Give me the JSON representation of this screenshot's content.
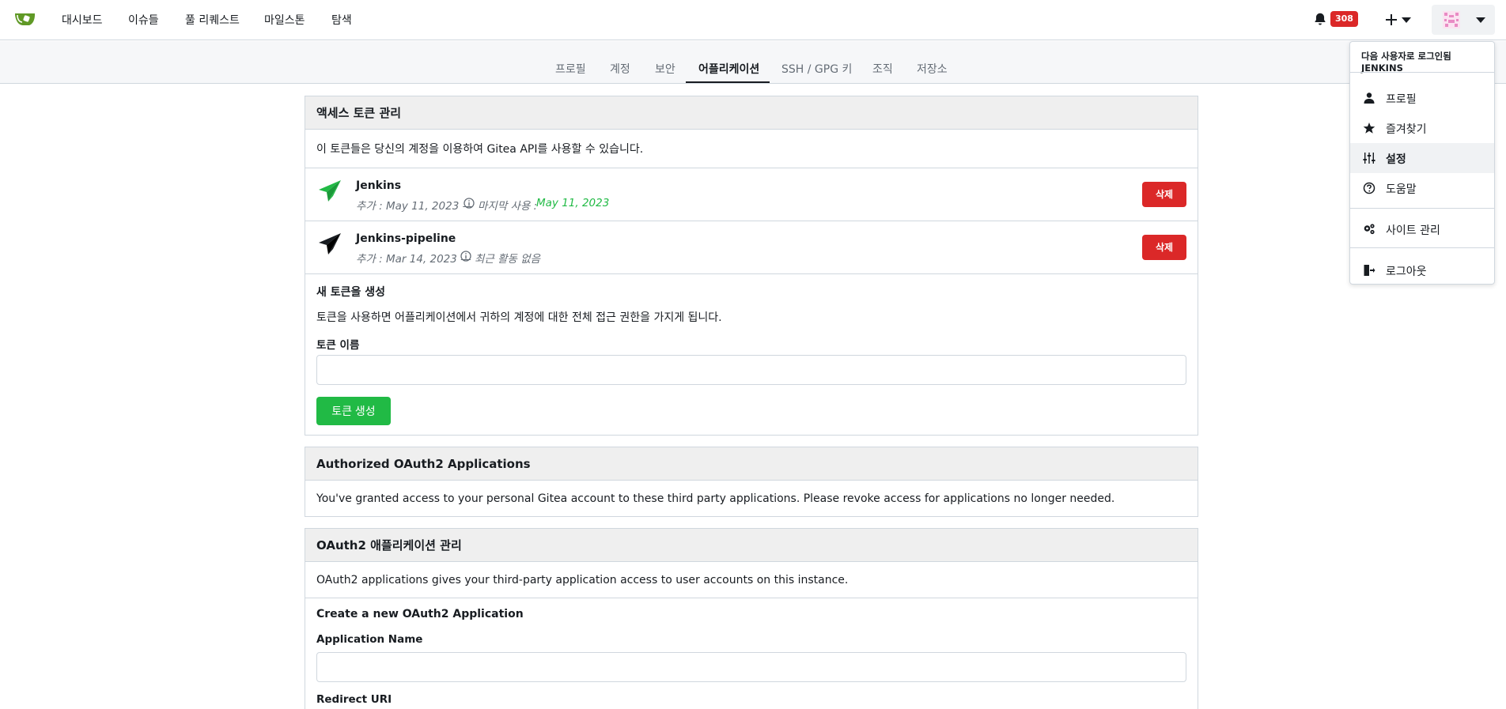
{
  "nav": {
    "items": [
      "대시보드",
      "이슈들",
      "풀 리퀘스트",
      "마일스톤",
      "탐색"
    ],
    "notification_count": "308"
  },
  "tabs": {
    "items": [
      "프로필",
      "계정",
      "보안",
      "어플리케이션",
      "SSH / GPG 키",
      "조직",
      "저장소"
    ],
    "active": "어플리케이션"
  },
  "tokens": {
    "title": "액세스 토큰 관리",
    "description": "이 토큰들은 당신의 계정을 이용하여 Gitea API를 사용할 수 있습니다.",
    "list": [
      {
        "name": "Jenkins",
        "added_label": "추가 : May 11, 2023 —",
        "usage_label": "마지막 사용 :",
        "usage_value": "May 11, 2023",
        "delete_label": "삭제",
        "icon_color": "#21ba45"
      },
      {
        "name": "Jenkins-pipeline",
        "added_label": "추가 : Mar 14, 2023 —",
        "usage_label": "최근 활동 없음",
        "usage_value": "",
        "delete_label": "삭제",
        "icon_color": "#181c21"
      }
    ],
    "new_title": "새 토큰을 생성",
    "new_desc": "토큰을 사용하면 어플리케이션에서 귀하의 계정에 대한 전체 접근 권한을 가지게 됩니다.",
    "name_label": "토큰 이름",
    "name_value": "",
    "generate_label": "토큰 생성"
  },
  "authorized": {
    "title": "Authorized OAuth2 Applications",
    "description": "You've granted access to your personal Gitea account to these third party applications. Please revoke access for applications no longer needed."
  },
  "oauth": {
    "title": "OAuth2 애플리케이션 관리",
    "description": "OAuth2 applications gives your third-party application access to user accounts on this instance.",
    "create_title": "Create a new OAuth2 Application",
    "app_name_label": "Application Name",
    "app_name_value": "",
    "redirect_label": "Redirect URI"
  },
  "dropdown": {
    "header": "다음 사용자로 로그인됨 JENKINS",
    "items": [
      {
        "label": "프로필",
        "icon": "person-icon"
      },
      {
        "label": "즐겨찾기",
        "icon": "star-icon"
      },
      {
        "label": "설정",
        "icon": "sliders-icon"
      },
      {
        "label": "도움말",
        "icon": "help-icon"
      },
      {
        "label": "사이트 관리",
        "icon": "gears-icon"
      },
      {
        "label": "로그아웃",
        "icon": "sign-out-icon"
      }
    ],
    "active": "설정"
  },
  "colors": {
    "accent_green": "#21ba45",
    "danger_red": "#db2828",
    "header_bg": "#efefef"
  }
}
